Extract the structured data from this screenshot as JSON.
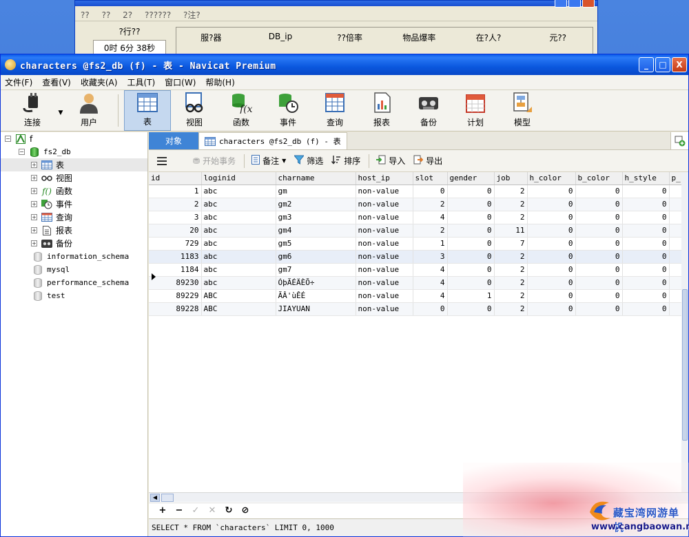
{
  "background_window": {
    "menu": [
      "??",
      "??",
      "2?",
      "??????",
      "?注?"
    ],
    "online_label": "?行??",
    "online_time": "0时 6分 38秒",
    "headers": [
      "服?器",
      "DB_ip",
      "??倍率",
      "物品爆率",
      "在?人?",
      "元??"
    ]
  },
  "window": {
    "title": "characters @fs2_db (f) - 表 - Navicat Premium",
    "minimize": "_",
    "maximize": "□",
    "close": "X"
  },
  "menubar": [
    "文件(F)",
    "查看(V)",
    "收藏夹(A)",
    "工具(T)",
    "窗口(W)",
    "帮助(H)"
  ],
  "toolbar": {
    "connect": "连接",
    "user": "用户",
    "table": "表",
    "view": "视图",
    "function": "函数",
    "event": "事件",
    "query": "查询",
    "report": "报表",
    "backup": "备份",
    "schedule": "计划",
    "model": "模型"
  },
  "sidebar": {
    "connection": "f",
    "database": "fs2_db",
    "children": [
      "表",
      "视图",
      "函数",
      "事件",
      "查询",
      "报表",
      "备份"
    ],
    "other_dbs": [
      "information_schema",
      "mysql",
      "performance_schema",
      "test"
    ]
  },
  "tabs": {
    "objects": "对象",
    "table_tab": "characters @fs2_db (f) - 表"
  },
  "actions": {
    "begin_transaction": "开始事务",
    "memo": "备注",
    "filter": "筛选",
    "sort": "排序",
    "import": "导入",
    "export": "导出"
  },
  "grid": {
    "columns": [
      "id",
      "loginid",
      "charname",
      "host_ip",
      "slot",
      "gender",
      "job",
      "h_color",
      "b_color",
      "h_style",
      "p_"
    ],
    "rows": [
      [
        "1",
        "abc",
        "gm",
        "non-value",
        "0",
        "0",
        "2",
        "0",
        "0",
        "0"
      ],
      [
        "2",
        "abc",
        "gm2",
        "non-value",
        "2",
        "0",
        "2",
        "0",
        "0",
        "0"
      ],
      [
        "3",
        "abc",
        "gm3",
        "non-value",
        "4",
        "0",
        "2",
        "0",
        "0",
        "0"
      ],
      [
        "20",
        "abc",
        "gm4",
        "non-value",
        "2",
        "0",
        "11",
        "0",
        "0",
        "0"
      ],
      [
        "729",
        "abc",
        "gm5",
        "non-value",
        "1",
        "0",
        "7",
        "0",
        "0",
        "0"
      ],
      [
        "1183",
        "abc",
        "gm6",
        "non-value",
        "3",
        "0",
        "2",
        "0",
        "0",
        "0"
      ],
      [
        "1184",
        "abc",
        "gm7",
        "non-value",
        "4",
        "0",
        "2",
        "0",
        "0",
        "0"
      ],
      [
        "89230",
        "abc",
        "ÓþÃÉÄÈÕ÷",
        "non-value",
        "4",
        "0",
        "2",
        "0",
        "0",
        "0"
      ],
      [
        "89229",
        "ABC",
        "ÃÂ'ùÊÉ",
        "non-value",
        "4",
        "1",
        "2",
        "0",
        "0",
        "0"
      ],
      [
        "89228",
        "ABC",
        "JIAYUAN",
        "non-value",
        "0",
        "0",
        "2",
        "0",
        "0",
        "0"
      ]
    ]
  },
  "navbar": [
    "+",
    "−",
    "✓",
    "✕",
    "↻",
    "⊘"
  ],
  "status": "SELECT * FROM `characters` LIMIT 0, 1000",
  "watermark": {
    "line1": "藏宝湾网游单机",
    "line2": "www.cangbaowan.net"
  }
}
